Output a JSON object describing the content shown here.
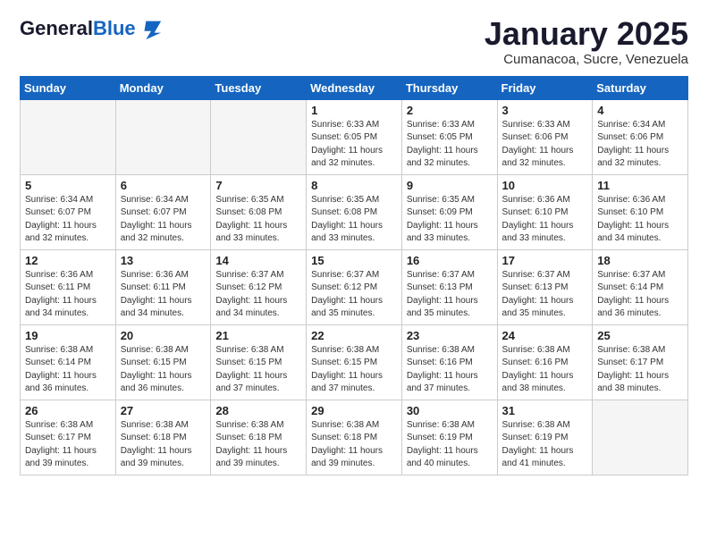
{
  "header": {
    "logo_general": "General",
    "logo_blue": "Blue",
    "month": "January 2025",
    "location": "Cumanacoa, Sucre, Venezuela"
  },
  "weekdays": [
    "Sunday",
    "Monday",
    "Tuesday",
    "Wednesday",
    "Thursday",
    "Friday",
    "Saturday"
  ],
  "weeks": [
    [
      {
        "day": "",
        "info": ""
      },
      {
        "day": "",
        "info": ""
      },
      {
        "day": "",
        "info": ""
      },
      {
        "day": "1",
        "info": "Sunrise: 6:33 AM\nSunset: 6:05 PM\nDaylight: 11 hours\nand 32 minutes."
      },
      {
        "day": "2",
        "info": "Sunrise: 6:33 AM\nSunset: 6:05 PM\nDaylight: 11 hours\nand 32 minutes."
      },
      {
        "day": "3",
        "info": "Sunrise: 6:33 AM\nSunset: 6:06 PM\nDaylight: 11 hours\nand 32 minutes."
      },
      {
        "day": "4",
        "info": "Sunrise: 6:34 AM\nSunset: 6:06 PM\nDaylight: 11 hours\nand 32 minutes."
      }
    ],
    [
      {
        "day": "5",
        "info": "Sunrise: 6:34 AM\nSunset: 6:07 PM\nDaylight: 11 hours\nand 32 minutes."
      },
      {
        "day": "6",
        "info": "Sunrise: 6:34 AM\nSunset: 6:07 PM\nDaylight: 11 hours\nand 32 minutes."
      },
      {
        "day": "7",
        "info": "Sunrise: 6:35 AM\nSunset: 6:08 PM\nDaylight: 11 hours\nand 33 minutes."
      },
      {
        "day": "8",
        "info": "Sunrise: 6:35 AM\nSunset: 6:08 PM\nDaylight: 11 hours\nand 33 minutes."
      },
      {
        "day": "9",
        "info": "Sunrise: 6:35 AM\nSunset: 6:09 PM\nDaylight: 11 hours\nand 33 minutes."
      },
      {
        "day": "10",
        "info": "Sunrise: 6:36 AM\nSunset: 6:10 PM\nDaylight: 11 hours\nand 33 minutes."
      },
      {
        "day": "11",
        "info": "Sunrise: 6:36 AM\nSunset: 6:10 PM\nDaylight: 11 hours\nand 34 minutes."
      }
    ],
    [
      {
        "day": "12",
        "info": "Sunrise: 6:36 AM\nSunset: 6:11 PM\nDaylight: 11 hours\nand 34 minutes."
      },
      {
        "day": "13",
        "info": "Sunrise: 6:36 AM\nSunset: 6:11 PM\nDaylight: 11 hours\nand 34 minutes."
      },
      {
        "day": "14",
        "info": "Sunrise: 6:37 AM\nSunset: 6:12 PM\nDaylight: 11 hours\nand 34 minutes."
      },
      {
        "day": "15",
        "info": "Sunrise: 6:37 AM\nSunset: 6:12 PM\nDaylight: 11 hours\nand 35 minutes."
      },
      {
        "day": "16",
        "info": "Sunrise: 6:37 AM\nSunset: 6:13 PM\nDaylight: 11 hours\nand 35 minutes."
      },
      {
        "day": "17",
        "info": "Sunrise: 6:37 AM\nSunset: 6:13 PM\nDaylight: 11 hours\nand 35 minutes."
      },
      {
        "day": "18",
        "info": "Sunrise: 6:37 AM\nSunset: 6:14 PM\nDaylight: 11 hours\nand 36 minutes."
      }
    ],
    [
      {
        "day": "19",
        "info": "Sunrise: 6:38 AM\nSunset: 6:14 PM\nDaylight: 11 hours\nand 36 minutes."
      },
      {
        "day": "20",
        "info": "Sunrise: 6:38 AM\nSunset: 6:15 PM\nDaylight: 11 hours\nand 36 minutes."
      },
      {
        "day": "21",
        "info": "Sunrise: 6:38 AM\nSunset: 6:15 PM\nDaylight: 11 hours\nand 37 minutes."
      },
      {
        "day": "22",
        "info": "Sunrise: 6:38 AM\nSunset: 6:15 PM\nDaylight: 11 hours\nand 37 minutes."
      },
      {
        "day": "23",
        "info": "Sunrise: 6:38 AM\nSunset: 6:16 PM\nDaylight: 11 hours\nand 37 minutes."
      },
      {
        "day": "24",
        "info": "Sunrise: 6:38 AM\nSunset: 6:16 PM\nDaylight: 11 hours\nand 38 minutes."
      },
      {
        "day": "25",
        "info": "Sunrise: 6:38 AM\nSunset: 6:17 PM\nDaylight: 11 hours\nand 38 minutes."
      }
    ],
    [
      {
        "day": "26",
        "info": "Sunrise: 6:38 AM\nSunset: 6:17 PM\nDaylight: 11 hours\nand 39 minutes."
      },
      {
        "day": "27",
        "info": "Sunrise: 6:38 AM\nSunset: 6:18 PM\nDaylight: 11 hours\nand 39 minutes."
      },
      {
        "day": "28",
        "info": "Sunrise: 6:38 AM\nSunset: 6:18 PM\nDaylight: 11 hours\nand 39 minutes."
      },
      {
        "day": "29",
        "info": "Sunrise: 6:38 AM\nSunset: 6:18 PM\nDaylight: 11 hours\nand 39 minutes."
      },
      {
        "day": "30",
        "info": "Sunrise: 6:38 AM\nSunset: 6:19 PM\nDaylight: 11 hours\nand 40 minutes."
      },
      {
        "day": "31",
        "info": "Sunrise: 6:38 AM\nSunset: 6:19 PM\nDaylight: 11 hours\nand 41 minutes."
      },
      {
        "day": "",
        "info": ""
      }
    ]
  ]
}
